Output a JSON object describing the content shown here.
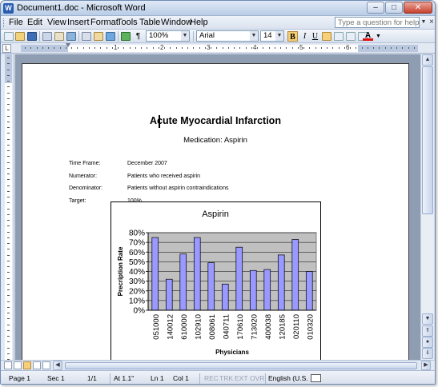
{
  "window": {
    "title": "Document1.doc - Microsoft Word",
    "app_icon": "W",
    "buttons": {
      "minimize": "–",
      "maximize": "□",
      "close": "✕"
    }
  },
  "menu": {
    "items": [
      "File",
      "Edit",
      "View",
      "Insert",
      "Format",
      "Tools",
      "Table",
      "Window",
      "Help"
    ],
    "help_placeholder": "Type a question for help",
    "close_doc": "×"
  },
  "toolbar": {
    "zoom": "100%",
    "style": "",
    "font": "Arial",
    "font_size": "14",
    "bold": "B",
    "italic": "I",
    "underline": "U",
    "paragraph_mark": "¶",
    "font_color_label": "A"
  },
  "ruler": {
    "corner": "L",
    "numbers": [
      "1",
      "2",
      "3",
      "4",
      "5",
      "6"
    ]
  },
  "document": {
    "title": "Acute Myocardial Infarction",
    "medication": "Medication: Aspirin",
    "fields": [
      {
        "label": "Time Frame:",
        "value": "December 2007"
      },
      {
        "label": "Numerator:",
        "value": "Patients who received aspirin"
      },
      {
        "label": "Denominator:",
        "value": "Patients without aspirin contraindications"
      },
      {
        "label": "Target:",
        "value": "100%"
      }
    ]
  },
  "chart_data": {
    "type": "bar",
    "title": "Aspirin",
    "xlabel": "Physicians",
    "ylabel": "Precription Rate",
    "ylim": [
      0,
      0.8
    ],
    "yticks": [
      "0%",
      "10%",
      "20%",
      "30%",
      "40%",
      "50%",
      "60%",
      "70%",
      "80%"
    ],
    "categories": [
      "051000",
      "140012",
      "610000",
      "102910",
      "008061",
      "040711",
      "170610",
      "713020",
      "400038",
      "120185",
      "020110",
      "010320"
    ],
    "values": [
      0.75,
      0.32,
      0.58,
      0.75,
      0.49,
      0.27,
      0.65,
      0.41,
      0.42,
      0.57,
      0.73,
      0.4
    ],
    "bar_color": "#9999ff",
    "plot_background": "#c0c0c0",
    "grid": true,
    "legend": "none"
  },
  "status": {
    "page": "Page  1",
    "sec": "Sec  1",
    "pages": "1/1",
    "at": "At  1.1\"",
    "ln": "Ln  1",
    "col": "Col  1",
    "rec": "REC",
    "trk": "TRK",
    "ext": "EXT",
    "ovr": "OVR",
    "language": "English (U.S."
  }
}
